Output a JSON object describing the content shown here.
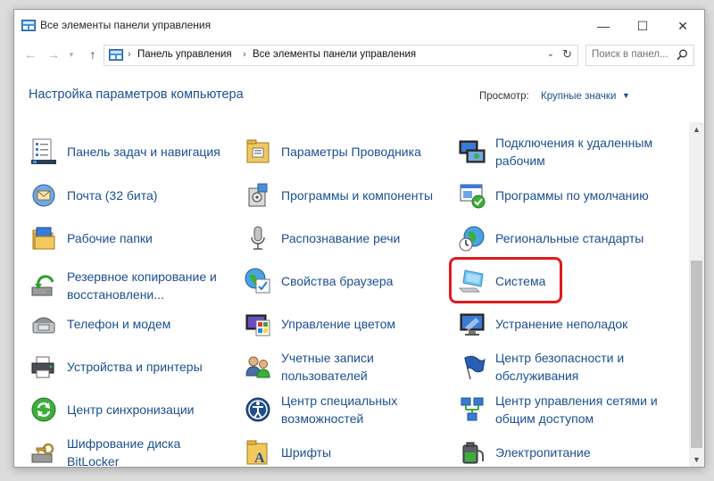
{
  "window": {
    "title": "Все элементы панели управления",
    "controls": {
      "minimize": "—",
      "maximize": "☐",
      "close": "✕"
    }
  },
  "address": {
    "crumbs": [
      "Панель управления",
      "Все элементы панели управления"
    ],
    "search_placeholder": "Поиск в панел..."
  },
  "header": {
    "title": "Настройка параметров компьютера",
    "view_label": "Просмотр:",
    "view_value": "Крупные значки"
  },
  "items": {
    "c1": [
      {
        "label": "Панель задач и навигация",
        "icon": "taskbar-icon"
      },
      {
        "label": "Почта (32 бита)",
        "icon": "mail-icon"
      },
      {
        "label": "Рабочие папки",
        "icon": "work-folders-icon"
      },
      {
        "label": "Резервное копирование и восстановлени...",
        "icon": "backup-icon"
      },
      {
        "label": "Телефон и модем",
        "icon": "phone-modem-icon"
      },
      {
        "label": "Устройства и принтеры",
        "icon": "printer-icon"
      },
      {
        "label": "Центр синхронизации",
        "icon": "sync-center-icon"
      },
      {
        "label": "Шифрование диска BitLocker",
        "icon": "bitlocker-icon"
      }
    ],
    "c2": [
      {
        "label": "Параметры Проводника",
        "icon": "explorer-options-icon"
      },
      {
        "label": "Программы и компоненты",
        "icon": "programs-icon"
      },
      {
        "label": "Распознавание речи",
        "icon": "microphone-icon"
      },
      {
        "label": "Свойства браузера",
        "icon": "internet-options-icon"
      },
      {
        "label": "Управление цветом",
        "icon": "color-management-icon"
      },
      {
        "label": "Учетные записи пользователей",
        "icon": "user-accounts-icon"
      },
      {
        "label": "Центр специальных возможностей",
        "icon": "accessibility-icon"
      },
      {
        "label": "Шрифты",
        "icon": "fonts-icon"
      }
    ],
    "c3": [
      {
        "label": "Подключения к удаленным рабочим",
        "icon": "remote-desktop-icon"
      },
      {
        "label": "Программы по умолчанию",
        "icon": "default-programs-icon"
      },
      {
        "label": "Региональные стандарты",
        "icon": "region-icon"
      },
      {
        "label": "Система",
        "icon": "system-icon"
      },
      {
        "label": "Устранение неполадок",
        "icon": "troubleshooting-icon"
      },
      {
        "label": "Центр безопасности и обслуживания",
        "icon": "security-flag-icon"
      },
      {
        "label": "Центр управления сетями и общим доступом",
        "icon": "network-center-icon"
      },
      {
        "label": "Электропитание",
        "icon": "power-options-icon"
      }
    ]
  },
  "colors": {
    "link": "#1b4f91",
    "highlight": "#e01b1b"
  }
}
